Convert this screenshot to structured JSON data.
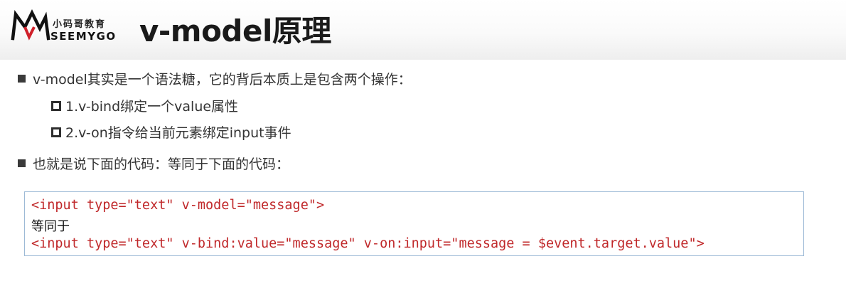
{
  "header": {
    "logo": {
      "brand_cn": "小码哥教育",
      "brand_en": "SEEMYGO"
    },
    "title": "v-model原理"
  },
  "content": {
    "bullets": [
      {
        "text": "v-model其实是一个语法糖，它的背后本质上是包含两个操作：",
        "sub": [
          "1.v-bind绑定一个value属性",
          "2.v-on指令给当前元素绑定input事件"
        ]
      },
      {
        "text": "也就是说下面的代码：等同于下面的代码："
      }
    ],
    "code": {
      "line1": "<input type=\"text\" v-model=\"message\">",
      "line2": "等同于",
      "line3": "<input type=\"text\" v-bind:value=\"message\" v-on:input=\"message = $event.target.value\">"
    }
  },
  "colors": {
    "code_text": "#c0282a",
    "code_border": "#9dbad6",
    "body_text": "#333333"
  }
}
